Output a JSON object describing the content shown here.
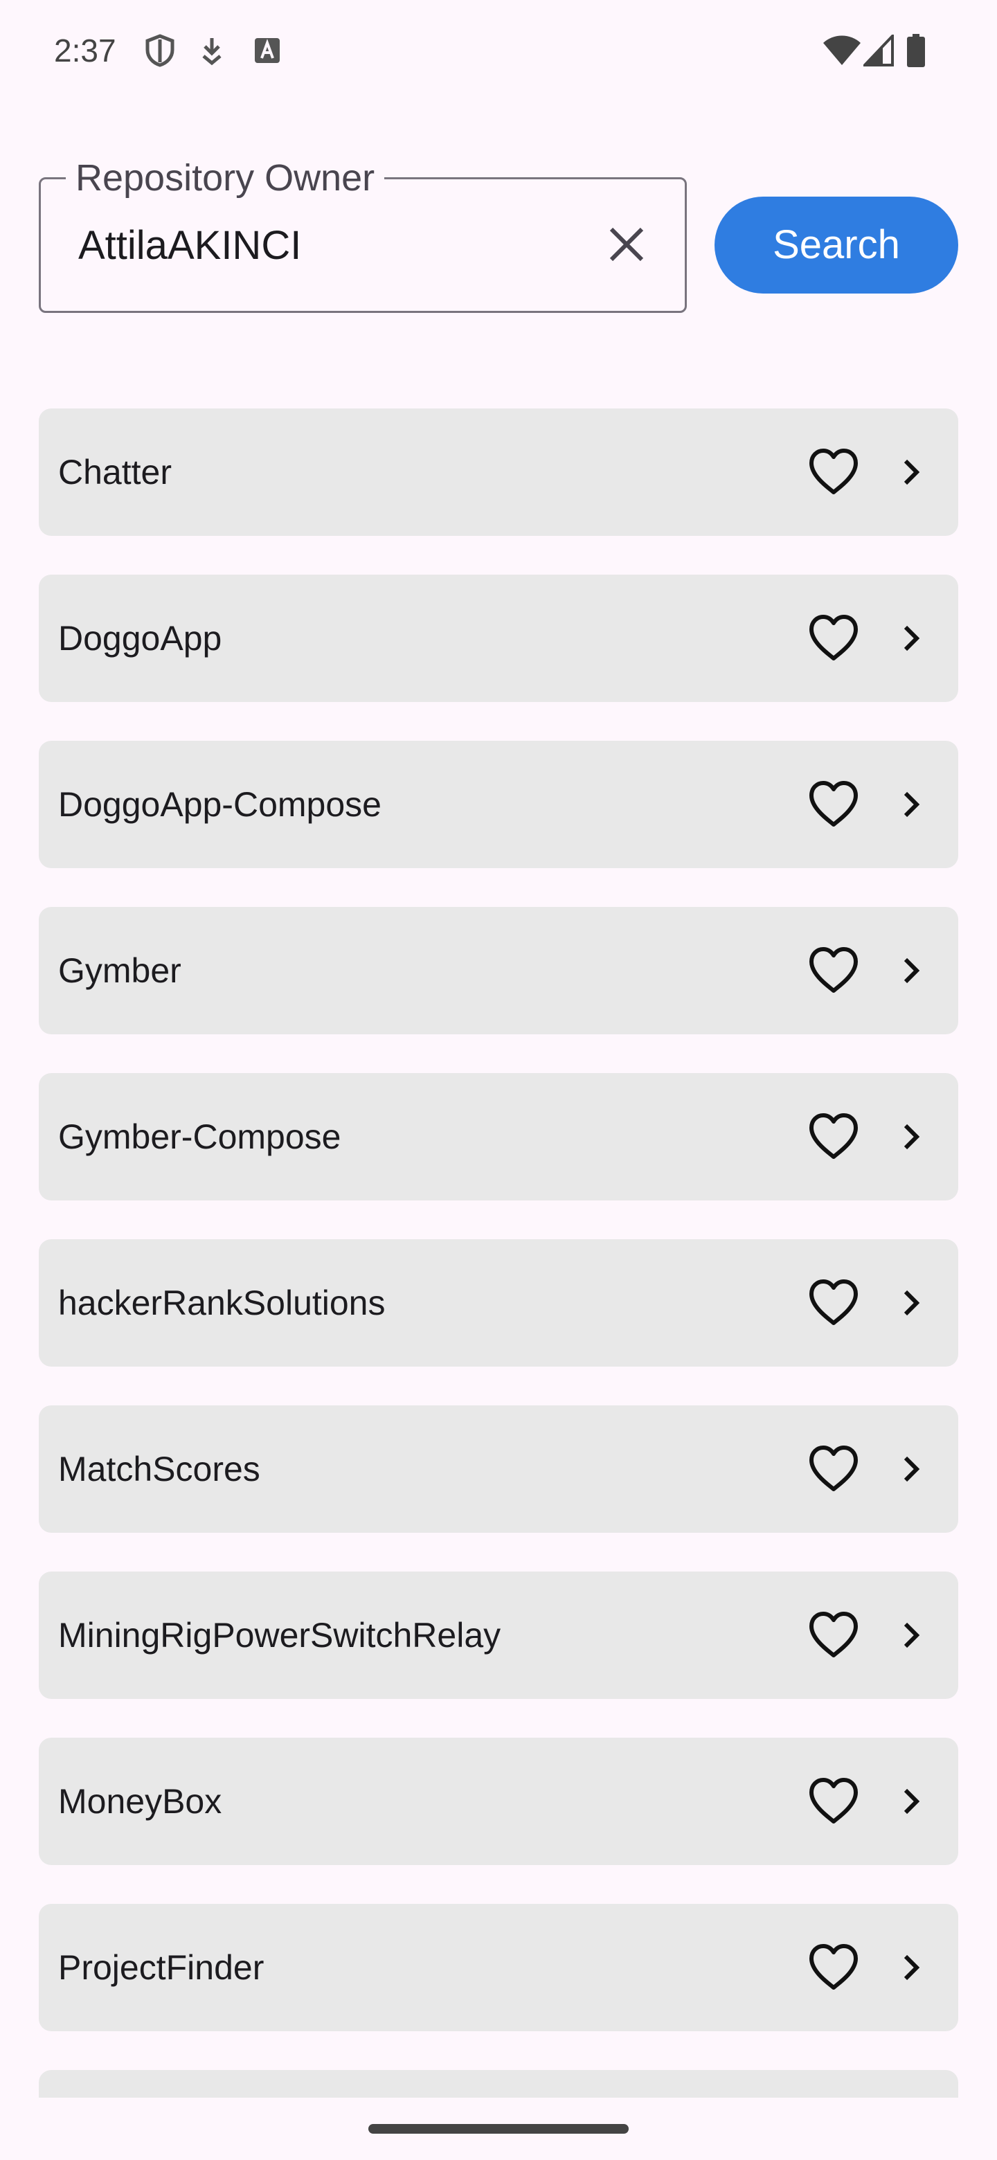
{
  "status_bar": {
    "time": "2:37",
    "left_icons": [
      "shield-icon",
      "download-icon",
      "keyboard-a-icon"
    ],
    "right_icons": [
      "wifi-icon",
      "signal-icon",
      "battery-icon"
    ]
  },
  "search": {
    "label": "Repository Owner",
    "value": "AttilaAKINCI",
    "clear_icon": "close-icon",
    "button_label": "Search",
    "button_color": "#2f7de1"
  },
  "repositories": [
    {
      "name": "Chatter"
    },
    {
      "name": "DoggoApp"
    },
    {
      "name": "DoggoApp-Compose"
    },
    {
      "name": "Gymber"
    },
    {
      "name": "Gymber-Compose"
    },
    {
      "name": "hackerRankSolutions"
    },
    {
      "name": "MatchScores"
    },
    {
      "name": "MiningRigPowerSwitchRelay"
    },
    {
      "name": "MoneyBox"
    },
    {
      "name": "ProjectFinder"
    },
    {
      "name": ""
    }
  ],
  "item_icons": {
    "favorite": "heart-outline-icon",
    "open": "chevron-right-icon"
  },
  "colors": {
    "background": "#fef7fd",
    "card": "#e8e8e8",
    "accent": "#2f7de1"
  }
}
